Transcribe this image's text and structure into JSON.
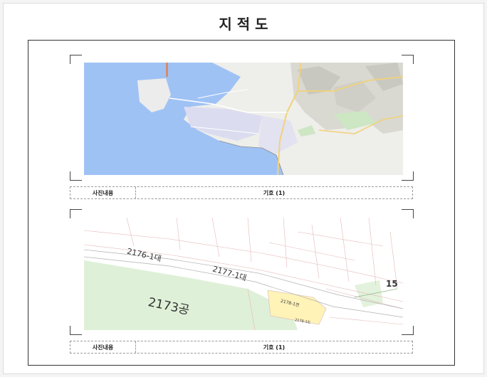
{
  "page": {
    "title": "지 적 도"
  },
  "photo1": {
    "caption_label": "사진내용",
    "caption_value": "기호 (1)"
  },
  "photo2": {
    "caption_label": "사진내용",
    "caption_value": "기호 (1)",
    "parcels": {
      "p1": "2176-1대",
      "p2": "2177-1대",
      "p3": "2173공",
      "p4": "2178-1전",
      "p5": "2178-1도",
      "p6": "15"
    }
  }
}
